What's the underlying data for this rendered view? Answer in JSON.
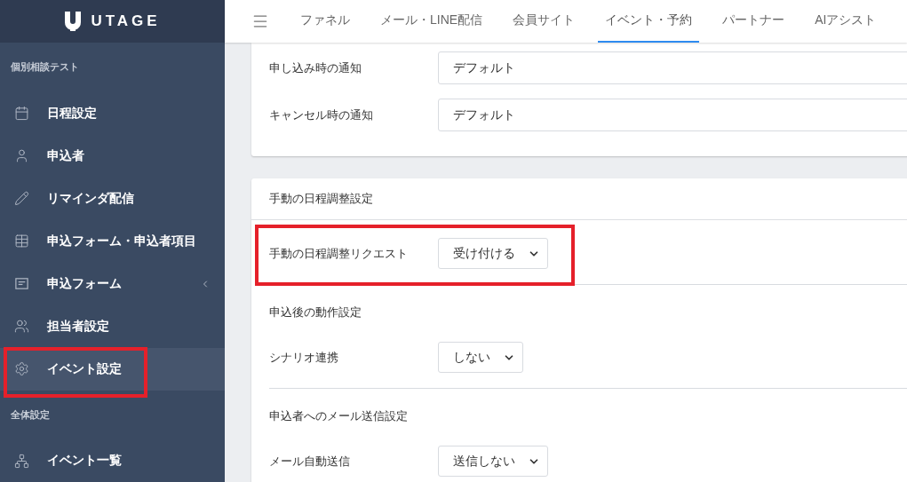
{
  "logo": {
    "text": "UTAGE"
  },
  "sidebar": {
    "sections": [
      {
        "title": "個別相談テスト",
        "items": [
          {
            "label": "日程設定",
            "kind": "link",
            "selected": false,
            "highlighted": false
          },
          {
            "label": "申込者",
            "kind": "link",
            "selected": false,
            "highlighted": false
          },
          {
            "label": "リマインダ配信",
            "kind": "link",
            "selected": false,
            "highlighted": false
          },
          {
            "label": "申込フォーム・申込者項目",
            "kind": "link",
            "selected": false,
            "highlighted": false
          },
          {
            "label": "申込フォーム",
            "kind": "submenu",
            "expanded": false,
            "selected": false,
            "highlighted": false
          },
          {
            "label": "担当者設定",
            "kind": "link",
            "selected": false,
            "highlighted": false
          },
          {
            "label": "イベント設定",
            "kind": "link",
            "selected": true,
            "highlighted": true
          }
        ]
      },
      {
        "title": "全体設定",
        "items": [
          {
            "label": "イベント一覧",
            "kind": "link",
            "selected": false,
            "highlighted": false
          }
        ]
      }
    ]
  },
  "tabs": [
    {
      "label": "ファネル",
      "selected": false
    },
    {
      "label": "メール・LINE配信",
      "selected": false
    },
    {
      "label": "会員サイト",
      "selected": false
    },
    {
      "label": "イベント・予約",
      "selected": true
    },
    {
      "label": "パートナー",
      "selected": false
    },
    {
      "label": "AIアシスト",
      "selected": false
    }
  ],
  "notification_card": {
    "fields": [
      {
        "label": "申し込み時の通知",
        "value": "デフォルト"
      },
      {
        "label": "キャンセル時の通知",
        "value": "デフォルト"
      }
    ]
  },
  "manual_card": {
    "title": "手動の日程調整設定",
    "groups": [
      {
        "fields": [
          {
            "label": "手動の日程調整リクエスト",
            "value": "受け付ける",
            "highlighted": true
          }
        ]
      },
      {
        "title": "申込後の動作設定",
        "fields": [
          {
            "label": "シナリオ連携",
            "value": "しない",
            "highlighted": false
          }
        ]
      },
      {
        "title": "申込者へのメール送信設定",
        "fields": [
          {
            "label": "メール自動送信",
            "value": "送信しない",
            "highlighted": false
          }
        ]
      }
    ]
  }
}
